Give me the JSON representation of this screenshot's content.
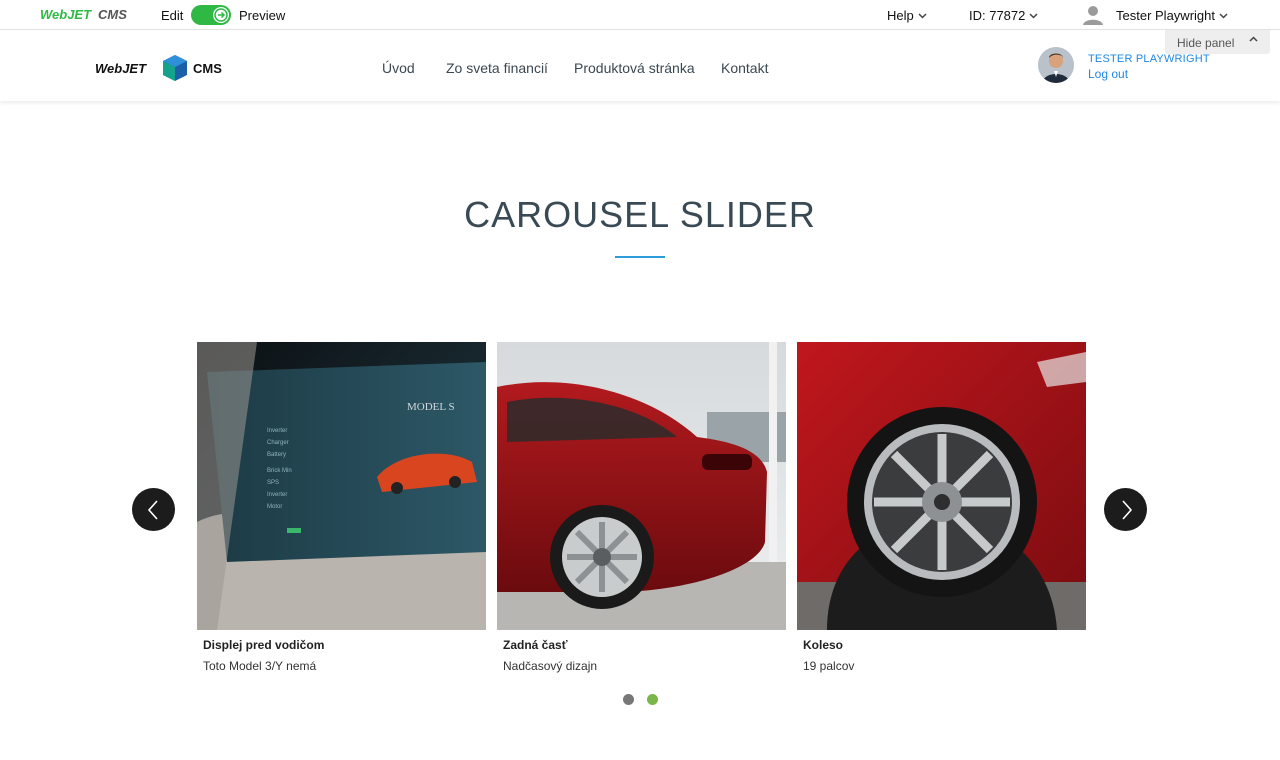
{
  "adminbar": {
    "edit_label": "Edit",
    "preview_label": "Preview",
    "help_label": "Help",
    "id_label": "ID: 77872",
    "user_label": "Tester Playwright",
    "hide_panel_label": "Hide panel",
    "toggle_state": "on"
  },
  "header": {
    "nav": [
      "Úvod",
      "Zo sveta financií",
      "Produktová stránka",
      "Kontakt"
    ],
    "user_name": "TESTER PLAYWRIGHT",
    "logout_label": "Log out"
  },
  "section": {
    "title": "CAROUSEL SLIDER"
  },
  "carousel": {
    "slides": [
      {
        "title": "Displej pred vodičom",
        "text": "Toto Model 3/Y nemá",
        "image": "dashboard-display-photo"
      },
      {
        "title": "Zadná časť",
        "text": "Nadčasový dizajn",
        "image": "red-car-rear-photo"
      },
      {
        "title": "Koleso",
        "text": "19 palcov",
        "image": "red-car-wheel-photo"
      }
    ],
    "dots": 2,
    "active_dot": 2
  },
  "colors": {
    "accent_green": "#2fb944",
    "link_blue": "#1e88e5",
    "title_line": "#2d9cdb",
    "dot_active": "#7ab648",
    "dot_inactive": "#777777"
  }
}
